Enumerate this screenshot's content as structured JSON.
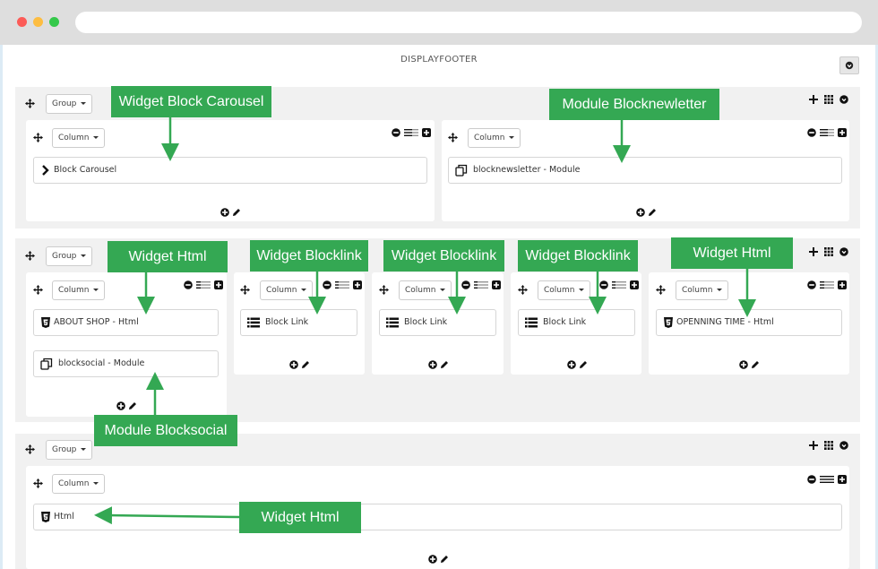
{
  "page": {
    "title": "DISPLAYFOOTER"
  },
  "labels": {
    "group": "Group",
    "column": "Column"
  },
  "items": {
    "block_carousel": "Block Carousel",
    "blocknewsletter": "blocknewsletter - Module",
    "about_shop": "ABOUT SHOP - Html",
    "blocksocial": "blocksocial - Module",
    "block_link_1": "Block Link",
    "block_link_2": "Block Link",
    "block_link_3": "Block Link",
    "openning_time": "OPENNING TIME - Html",
    "html": "Html"
  },
  "callouts": {
    "widget_block_carousel": "Widget Block Carousel",
    "module_blocknewletter": "Module Blocknewletter",
    "widget_html_1": "Widget Html",
    "widget_blocklink_1": "Widget Blocklink",
    "widget_blocklink_2": "Widget Blocklink",
    "widget_blocklink_3": "Widget Blocklink",
    "widget_html_2": "Widget Html",
    "module_blocksocial": "Module Blocksocial",
    "widget_html_3": "Widget Html"
  },
  "icons": {
    "move": "move-icon",
    "plus": "plus-icon",
    "grid": "grid-icon",
    "power": "power-icon",
    "minus": "minus-icon",
    "width": "width-bars-icon",
    "edit": "pencil-icon",
    "html5": "html5-icon",
    "module": "module-icon",
    "list": "list-icon",
    "chevron": "chevron-right-icon"
  },
  "colors": {
    "callout": "#34a853",
    "group_bg": "#f1f1f1",
    "column_bg": "#ffffff"
  }
}
